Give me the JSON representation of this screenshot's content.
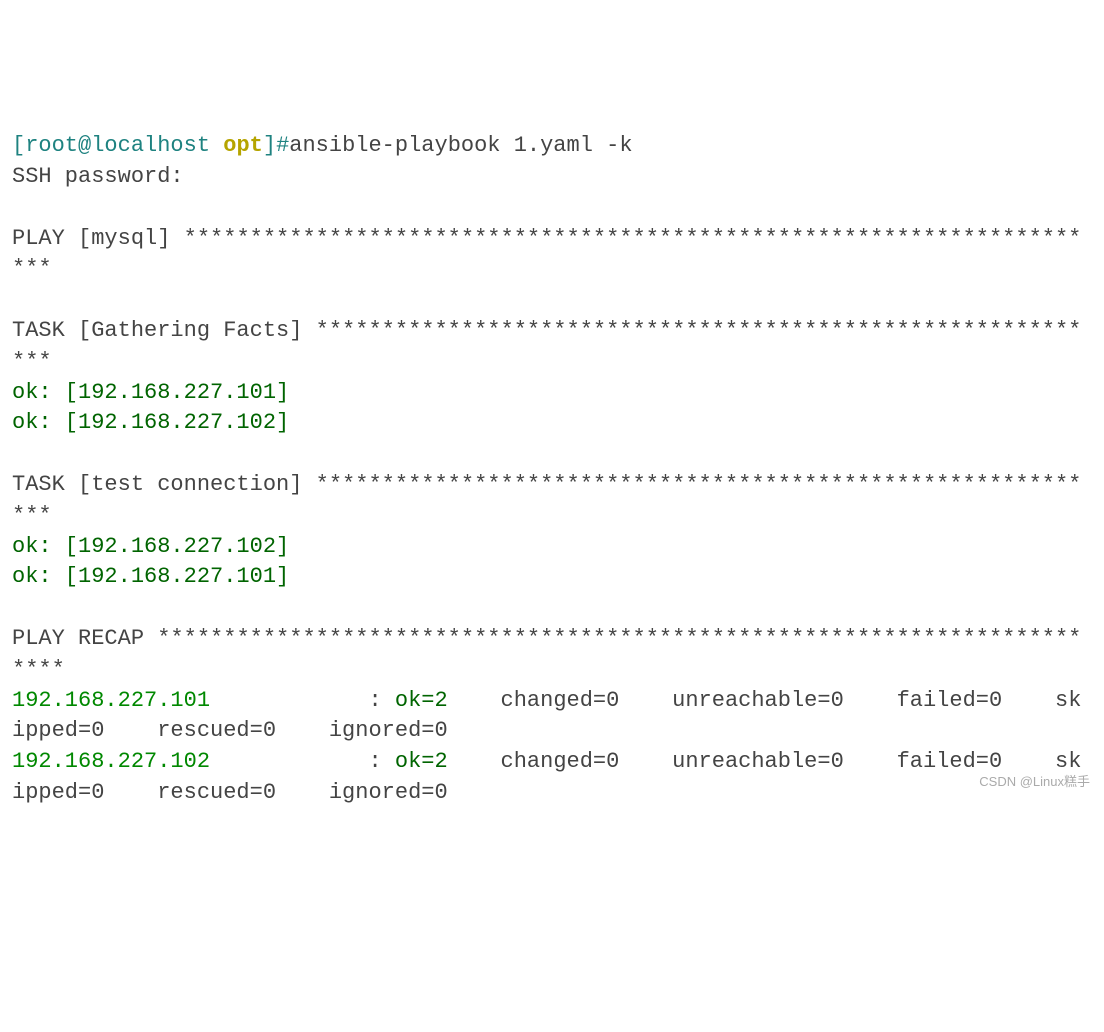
{
  "prompt": {
    "bracket_open": "[",
    "user_host": "root@localhost",
    "cwd": "opt",
    "bracket_close": "]",
    "hash": "#",
    "command": "ansible-playbook 1.yaml -k"
  },
  "ssh_prompt": "SSH password:",
  "play": {
    "label": "PLAY [mysql] ",
    "stars": "***********************************************************************"
  },
  "task_gathering": {
    "label": "TASK [Gathering Facts] ",
    "stars": "*************************************************************",
    "results": [
      "ok: [192.168.227.101]",
      "ok: [192.168.227.102]"
    ]
  },
  "task_test": {
    "label": "TASK [test connection] ",
    "stars": "*************************************************************",
    "results": [
      "ok: [192.168.227.102]",
      "ok: [192.168.227.101]"
    ]
  },
  "recap": {
    "label": "PLAY RECAP ",
    "stars": "**************************************************************************",
    "hosts": [
      {
        "ip": "192.168.227.101",
        "sep": "            : ",
        "ok": "ok=2   ",
        "rest": " changed=0    unreachable=0    failed=0    skipped=0    rescued=0    ignored=0"
      },
      {
        "ip": "192.168.227.102",
        "sep": "            : ",
        "ok": "ok=2   ",
        "rest": " changed=0    unreachable=0    failed=0    skipped=0    rescued=0    ignored=0"
      }
    ]
  },
  "watermark": "CSDN @Linux糕手"
}
